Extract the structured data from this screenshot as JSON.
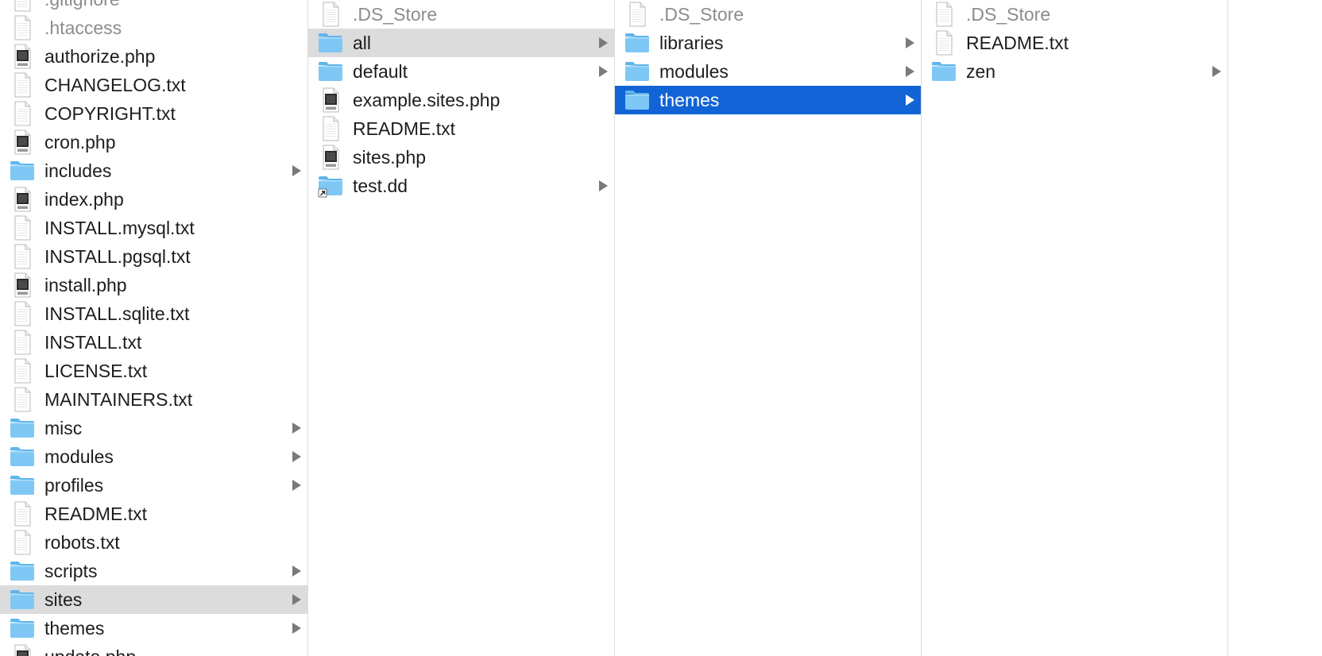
{
  "colors": {
    "selection_active": "#1263d6",
    "selection_inactive": "#dcdcdc",
    "folder": "#7fc8f5",
    "text": "#1d1d1d",
    "text_dim": "#8c8c8c"
  },
  "columns": [
    {
      "items": [
        {
          "name": ".gitignore",
          "kind": "file",
          "icon": "text-file-icon",
          "dim": true
        },
        {
          "name": ".htaccess",
          "kind": "file",
          "icon": "text-file-icon",
          "dim": true
        },
        {
          "name": "authorize.php",
          "kind": "php",
          "icon": "php-file-icon"
        },
        {
          "name": "CHANGELOG.txt",
          "kind": "file",
          "icon": "text-file-icon"
        },
        {
          "name": "COPYRIGHT.txt",
          "kind": "file",
          "icon": "text-file-icon"
        },
        {
          "name": "cron.php",
          "kind": "php",
          "icon": "php-file-icon"
        },
        {
          "name": "includes",
          "kind": "folder",
          "icon": "folder-icon"
        },
        {
          "name": "index.php",
          "kind": "php",
          "icon": "php-file-icon"
        },
        {
          "name": "INSTALL.mysql.txt",
          "kind": "file",
          "icon": "text-file-icon"
        },
        {
          "name": "INSTALL.pgsql.txt",
          "kind": "file",
          "icon": "text-file-icon"
        },
        {
          "name": "install.php",
          "kind": "php",
          "icon": "php-file-icon"
        },
        {
          "name": "INSTALL.sqlite.txt",
          "kind": "file",
          "icon": "text-file-icon"
        },
        {
          "name": "INSTALL.txt",
          "kind": "file",
          "icon": "text-file-icon"
        },
        {
          "name": "LICENSE.txt",
          "kind": "file",
          "icon": "text-file-icon"
        },
        {
          "name": "MAINTAINERS.txt",
          "kind": "file",
          "icon": "text-file-icon"
        },
        {
          "name": "misc",
          "kind": "folder",
          "icon": "folder-icon"
        },
        {
          "name": "modules",
          "kind": "folder",
          "icon": "folder-icon"
        },
        {
          "name": "profiles",
          "kind": "folder",
          "icon": "folder-icon"
        },
        {
          "name": "README.txt",
          "kind": "file",
          "icon": "text-file-icon"
        },
        {
          "name": "robots.txt",
          "kind": "file",
          "icon": "text-file-icon"
        },
        {
          "name": "scripts",
          "kind": "folder",
          "icon": "folder-icon"
        },
        {
          "name": "sites",
          "kind": "folder",
          "icon": "folder-icon",
          "selected": "inactive"
        },
        {
          "name": "themes",
          "kind": "folder",
          "icon": "folder-icon"
        },
        {
          "name": "update.php",
          "kind": "php",
          "icon": "php-file-icon"
        }
      ]
    },
    {
      "items": [
        {
          "name": ".DS_Store",
          "kind": "file",
          "icon": "text-file-icon",
          "dim": true
        },
        {
          "name": "all",
          "kind": "folder",
          "icon": "folder-icon",
          "selected": "inactive"
        },
        {
          "name": "default",
          "kind": "folder",
          "icon": "folder-icon"
        },
        {
          "name": "example.sites.php",
          "kind": "php",
          "icon": "php-file-icon"
        },
        {
          "name": "README.txt",
          "kind": "file",
          "icon": "text-file-icon"
        },
        {
          "name": "sites.php",
          "kind": "php",
          "icon": "php-file-icon"
        },
        {
          "name": "test.dd",
          "kind": "alias",
          "icon": "folder-alias-icon"
        }
      ]
    },
    {
      "items": [
        {
          "name": ".DS_Store",
          "kind": "file",
          "icon": "text-file-icon",
          "dim": true
        },
        {
          "name": "libraries",
          "kind": "folder",
          "icon": "folder-icon"
        },
        {
          "name": "modules",
          "kind": "folder",
          "icon": "folder-icon"
        },
        {
          "name": "themes",
          "kind": "folder",
          "icon": "folder-icon",
          "selected": "active"
        }
      ]
    },
    {
      "items": [
        {
          "name": ".DS_Store",
          "kind": "file",
          "icon": "text-file-icon",
          "dim": true
        },
        {
          "name": "README.txt",
          "kind": "file",
          "icon": "text-file-icon"
        },
        {
          "name": "zen",
          "kind": "folder",
          "icon": "folder-icon"
        }
      ]
    }
  ]
}
